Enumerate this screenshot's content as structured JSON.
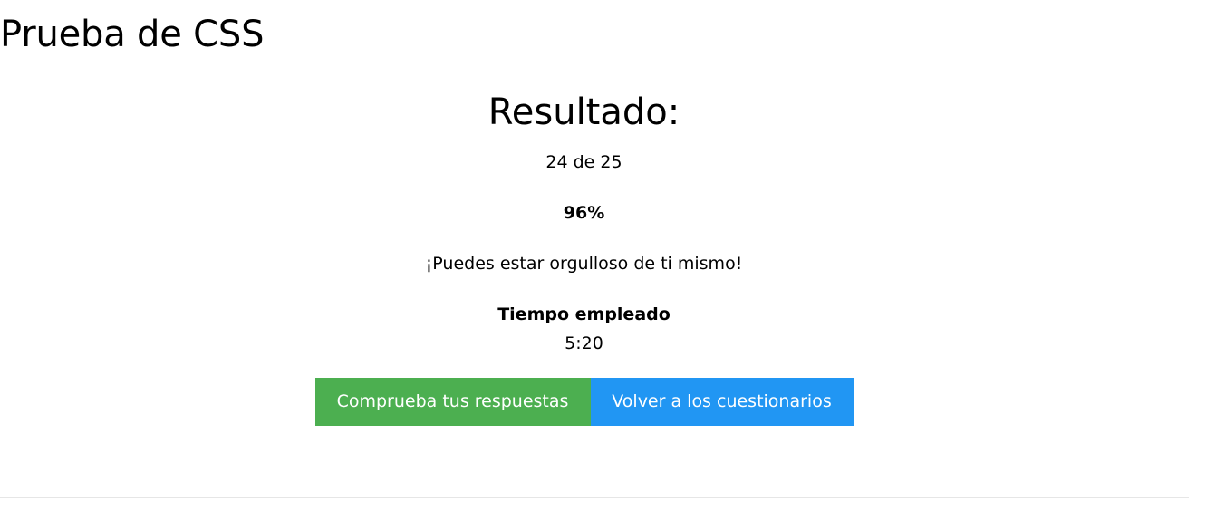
{
  "page": {
    "title": "Prueba de CSS"
  },
  "result": {
    "heading": "Resultado:",
    "score": "24 de 25",
    "percent": "96%",
    "message": "¡Puedes estar orgulloso de ti mismo!",
    "time_label": "Tiempo empleado",
    "time_value": "5:20"
  },
  "actions": {
    "check_answers_label": "Comprueba tus respuestas",
    "back_to_quizzes_label": "Volver a los cuestionarios"
  },
  "colors": {
    "check_button": "#4caf50",
    "back_button": "#2196f3",
    "divider": "#e6e6e6"
  }
}
